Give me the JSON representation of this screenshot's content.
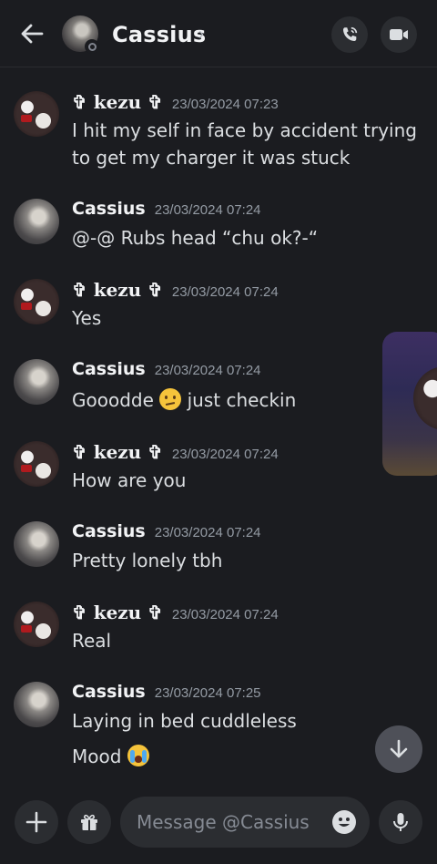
{
  "header": {
    "title": "Cassius",
    "chevron": "›",
    "icons": {
      "back": "arrow-left-icon",
      "call": "phone-call-icon",
      "video": "video-camera-icon"
    }
  },
  "messages": [
    {
      "author": "✞ kezu ✞",
      "style": "kezu",
      "timestamp": "23/03/2024 07:23",
      "lines": [
        "I hit my self in face by accident trying",
        "to get my charger it was stuck"
      ]
    },
    {
      "author": "Cassius",
      "style": "cassius",
      "timestamp": "23/03/2024 07:24",
      "lines": [
        "@-@ Rubs head “chu ok?-“"
      ]
    },
    {
      "author": "✞ kezu ✞",
      "style": "kezu",
      "timestamp": "23/03/2024 07:24",
      "lines": [
        "Yes"
      ]
    },
    {
      "author": "Cassius",
      "style": "cassius",
      "timestamp": "23/03/2024 07:24",
      "text_before": "Gooodde",
      "text_after": "just checkin",
      "emoji": "confused-face-emoji"
    },
    {
      "author": "✞ kezu ✞",
      "style": "kezu",
      "timestamp": "23/03/2024 07:24",
      "lines": [
        "How are you"
      ]
    },
    {
      "author": "Cassius",
      "style": "cassius",
      "timestamp": "23/03/2024 07:24",
      "lines": [
        "Pretty lonely tbh"
      ]
    },
    {
      "author": "✞ kezu ✞",
      "style": "kezu",
      "timestamp": "23/03/2024 07:24",
      "lines": [
        "Real"
      ]
    },
    {
      "author": "Cassius",
      "style": "cassius",
      "timestamp": "23/03/2024 07:25",
      "lines": [
        "Laying in bed cuddleless"
      ],
      "extra_text": "Mood",
      "extra_emoji": "loudly-crying-face-emoji"
    }
  ],
  "composer": {
    "placeholder": "Message @Cassius",
    "icons": {
      "plus": "plus-icon",
      "gift": "gift-icon",
      "emoji": "emoji-smile-icon",
      "mic": "microphone-icon"
    }
  },
  "colors": {
    "background": "#1b1c20",
    "surface": "#2b2d31",
    "text": "#dbdee1",
    "muted": "#949ba4"
  }
}
